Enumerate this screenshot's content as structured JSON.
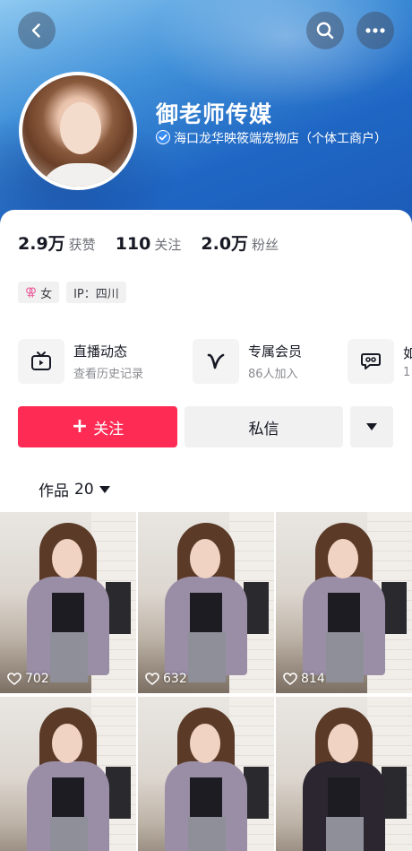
{
  "profile": {
    "name": "御老师传媒",
    "verified_text": "海口龙华映筱端宠物店（个体工商户）"
  },
  "stats": [
    {
      "value": "2.9万",
      "label": "获赞"
    },
    {
      "value": "110",
      "label": "关注"
    },
    {
      "value": "2.0万",
      "label": "粉丝"
    }
  ],
  "tags": {
    "gender": "女",
    "ip": "IP：四川"
  },
  "features": [
    {
      "title": "直播动态",
      "subtitle": "查看历史记录",
      "icon": "tv-icon"
    },
    {
      "title": "专属会员",
      "subtitle": "86人加入",
      "icon": "v-icon"
    },
    {
      "title": "如",
      "subtitle": "1",
      "icon": "chat-bubble-icon"
    }
  ],
  "actions": {
    "follow": "关注",
    "message": "私信"
  },
  "works": {
    "label": "作品",
    "count": "20"
  },
  "videos": [
    {
      "likes": "702"
    },
    {
      "likes": "632"
    },
    {
      "likes": "814"
    },
    {
      "likes": ""
    },
    {
      "likes": ""
    },
    {
      "likes": ""
    }
  ],
  "colors": {
    "follow_button": "#fe2c55",
    "header_blue": "#1f67c4"
  }
}
